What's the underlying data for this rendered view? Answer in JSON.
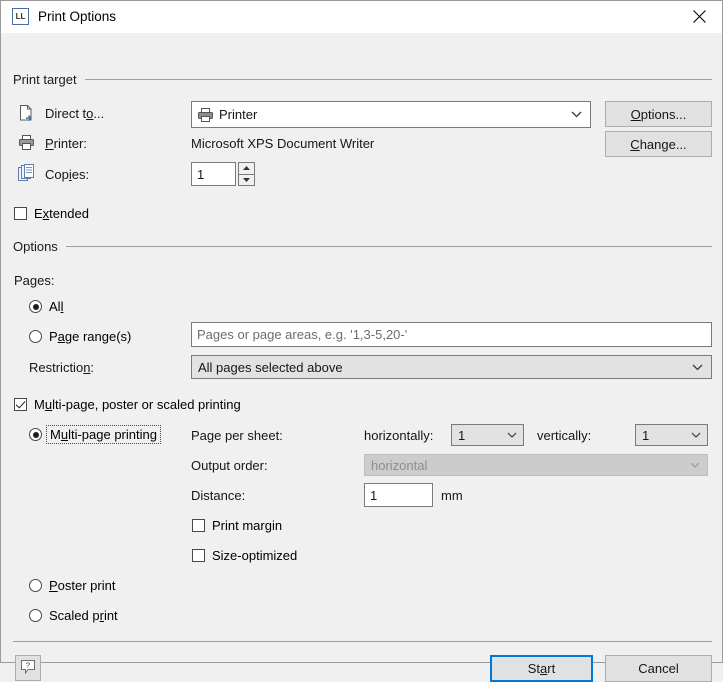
{
  "window": {
    "title": "Print Options",
    "app_icon_text": "LL",
    "close_icon": "close-icon"
  },
  "print_target": {
    "group_label": "Print target",
    "direct_to": {
      "label_pre": "Direct t",
      "label_accel": "o",
      "label_post": "...",
      "label_full": "Direct to...",
      "value": "Printer",
      "icon": "printer-icon"
    },
    "printer": {
      "label_pre": "",
      "label_accel": "P",
      "label_post": "rinter:",
      "label_full": "Printer:",
      "value": "Microsoft XPS Document Writer",
      "icon": "printer-icon"
    },
    "copies": {
      "label_pre": "Cop",
      "label_accel": "i",
      "label_post": "es:",
      "label_full": "Copies:",
      "value": "1",
      "icon": "copies-icon"
    },
    "options_button": {
      "label_pre": "",
      "label_accel": "O",
      "label_post": "ptions...",
      "label_full": "Options..."
    },
    "change_button": {
      "label_pre": "",
      "label_accel": "C",
      "label_post": "hange...",
      "label_full": "Change..."
    },
    "extended_checkbox": {
      "label_pre": "E",
      "label_accel": "x",
      "label_post": "tended",
      "label_full": "Extended",
      "checked": false
    }
  },
  "options": {
    "group_label": "Options",
    "pages_label": "Pages:",
    "all_radio": {
      "label_pre": "Al",
      "label_accel": "l",
      "label_post": "",
      "label_full": "All",
      "selected": true
    },
    "page_range_radio": {
      "label_pre": "P",
      "label_accel": "a",
      "label_post": "ge range(s)",
      "label_full": "Page range(s)",
      "selected": false
    },
    "page_range_input": {
      "value": "",
      "placeholder": "Pages or page areas, e.g. '1,3-5,20-'"
    },
    "restriction": {
      "label_pre": "Restrictio",
      "label_accel": "n",
      "label_post": ":",
      "label_full": "Restriction:",
      "value": "All pages selected above"
    },
    "multipage_checkbox": {
      "label_pre": "M",
      "label_accel": "u",
      "label_post": "lti-page, poster or scaled printing",
      "label_full": "Multi-page, poster or scaled printing",
      "checked": true
    },
    "multipage_radio": {
      "label_pre": "M",
      "label_accel": "u",
      "label_post": "lti-page printing",
      "label_full": "Multi-page printing",
      "selected": true,
      "focused": true
    },
    "page_per_sheet_label": "Page per sheet:",
    "horizontally_label": "horizontally:",
    "horizontally_value": "1",
    "vertically_label": "vertically:",
    "vertically_value": "1",
    "output_order_label": "Output order:",
    "output_order_value": "horizontal",
    "distance_label": "Distance:",
    "distance_value": "1",
    "distance_unit": "mm",
    "print_margin_checkbox": {
      "label_full": "Print margin",
      "checked": false
    },
    "size_optimized_checkbox": {
      "label_full": "Size-optimized",
      "checked": false
    },
    "poster_print_radio": {
      "label_pre": "",
      "label_accel": "P",
      "label_post": "oster print",
      "label_full": "Poster print",
      "selected": false
    },
    "scaled_print_radio": {
      "label_pre": "Scaled p",
      "label_accel": "r",
      "label_post": "int",
      "label_full": "Scaled print",
      "selected": false
    }
  },
  "footer": {
    "help_icon": "help-icon",
    "start_button": {
      "label_pre": "St",
      "label_accel": "a",
      "label_post": "rt",
      "label_full": "Start"
    },
    "cancel_button": {
      "label_full": "Cancel"
    }
  },
  "colors": {
    "dialog_bg": "#f0f0f0",
    "accent": "#0078d7",
    "border": "#7a7a7a",
    "disabled_bg": "#cccccc"
  }
}
